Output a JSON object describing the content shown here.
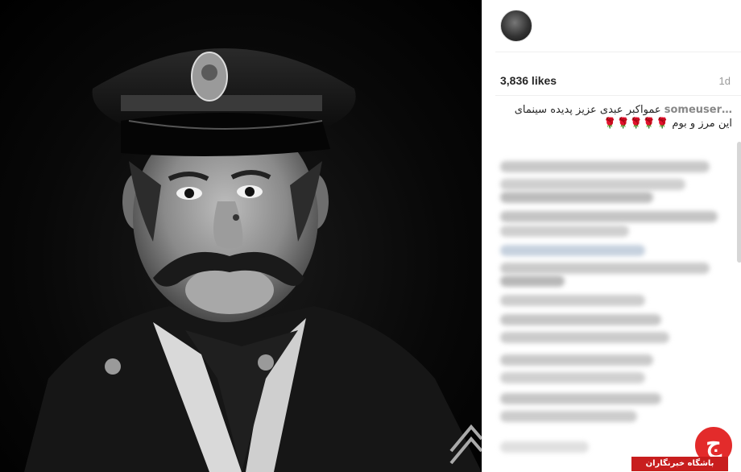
{
  "post": {
    "likes": "3,836 likes",
    "time": "1d",
    "caption_username": "someuser…",
    "caption_text": "عمواکبر عبدی عزیز پدیده سینمای این مرز و بوم",
    "caption_emoji": "🌹🌹🌹🌹🌹"
  },
  "watermark": {
    "label": "باشگاه خبرنگاران",
    "logo_glyph": "ج"
  },
  "colors": {
    "photo_bg": "#000000",
    "accent_red": "#e32b2b"
  }
}
